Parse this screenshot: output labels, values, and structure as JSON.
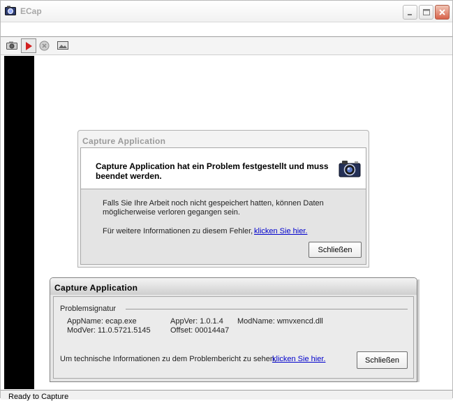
{
  "window": {
    "title": "ECap"
  },
  "status": {
    "text": "Ready to Capture"
  },
  "dialog_inactive": {
    "title": "Capture Application",
    "heading": "Capture Application hat ein Problem festgestellt und muss beendet werden.",
    "message": "Falls Sie Ihre Arbeit noch nicht gespeichert hatten, können Daten möglicherweise verloren gegangen sein.",
    "more_info": "Für weitere Informationen zu diesem Fehler,",
    "link": "klicken Sie hier.",
    "close_label": "Schließen"
  },
  "dialog_active": {
    "title": "Capture Application",
    "group_label": "Problemsignatur",
    "signature": {
      "appname": "AppName: ecap.exe",
      "appver": "AppVer: 1.0.1.4",
      "modname": "ModName: wmvxencd.dll",
      "modver": "ModVer: 11.0.5721.5145",
      "offset": "Offset: 000144a7"
    },
    "tech_info": "Um technische Informationen zu dem Problembericht zu sehen,",
    "link": "klicken Sie hier.",
    "close_label": "Schließen"
  }
}
